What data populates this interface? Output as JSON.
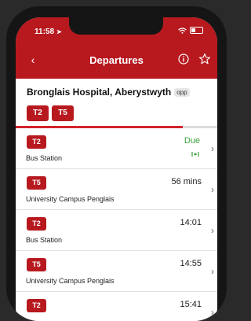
{
  "status_bar": {
    "time": "11:58",
    "location_arrow": "➤"
  },
  "nav": {
    "back_icon": "‹",
    "title": "Departures"
  },
  "stop": {
    "name": "Bronglais Hospital, Aberystwyth",
    "code": "opp",
    "routes": [
      "T2",
      "T5"
    ]
  },
  "refresh_progress": 0.83,
  "departures": [
    {
      "route": "T2",
      "destination": "Bus Station",
      "time": "Due",
      "live": true
    },
    {
      "route": "T5",
      "destination": "University Campus Penglais",
      "time": "56 mins",
      "live": false
    },
    {
      "route": "T2",
      "destination": "Bus Station",
      "time": "14:01",
      "live": false
    },
    {
      "route": "T5",
      "destination": "University Campus Penglais",
      "time": "14:55",
      "live": false
    },
    {
      "route": "T2",
      "destination": "",
      "time": "15:41",
      "live": false
    }
  ],
  "chevron": "›",
  "colors": {
    "brand_red": "#b7191f",
    "due_green": "#3aa13a"
  },
  "icons": {
    "info": "info-icon",
    "favorite": "star-icon",
    "wifi": "wifi-icon",
    "battery": "battery-icon",
    "live": "live-tracking-icon"
  }
}
